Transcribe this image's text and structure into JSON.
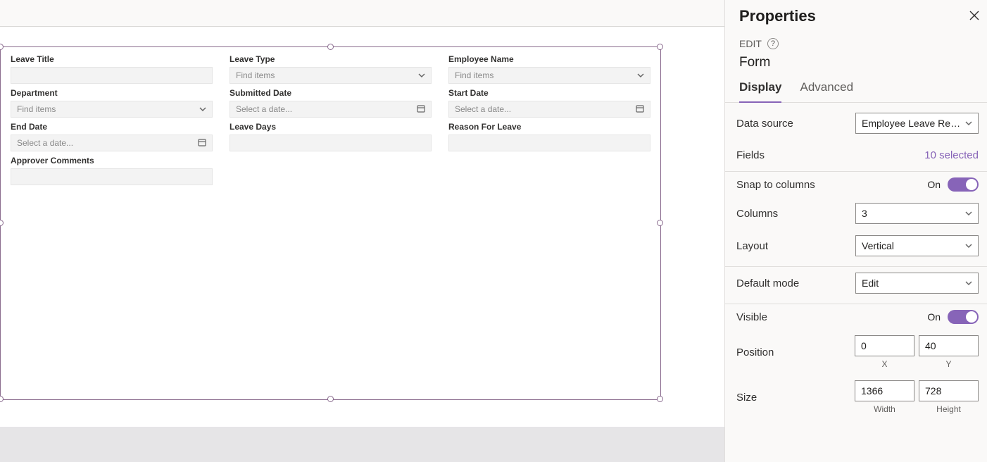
{
  "form": {
    "fields": {
      "leave_title": {
        "label": "Leave Title",
        "placeholder": "",
        "type": "text"
      },
      "leave_type": {
        "label": "Leave Type",
        "placeholder": "Find items",
        "type": "dropdown"
      },
      "employee_name": {
        "label": "Employee Name",
        "placeholder": "Find items",
        "type": "dropdown"
      },
      "department": {
        "label": "Department",
        "placeholder": "Find items",
        "type": "dropdown"
      },
      "submitted_date": {
        "label": "Submitted Date",
        "placeholder": "Select a date...",
        "type": "date"
      },
      "start_date": {
        "label": "Start Date",
        "placeholder": "Select a date...",
        "type": "date"
      },
      "end_date": {
        "label": "End Date",
        "placeholder": "Select a date...",
        "type": "date"
      },
      "leave_days": {
        "label": "Leave Days",
        "placeholder": "",
        "type": "text"
      },
      "reason_for_leave": {
        "label": "Reason For Leave",
        "placeholder": "",
        "type": "text"
      },
      "approver_comments": {
        "label": "Approver Comments",
        "placeholder": "",
        "type": "text"
      }
    }
  },
  "properties": {
    "panel_title": "Properties",
    "edit_label": "EDIT",
    "control_name": "Form",
    "tabs": {
      "display": "Display",
      "advanced": "Advanced"
    },
    "data_source": {
      "label": "Data source",
      "value": "Employee Leave Re…"
    },
    "fields": {
      "label": "Fields",
      "value": "10 selected"
    },
    "snap_to_cols": {
      "label": "Snap to columns",
      "state": "On"
    },
    "columns": {
      "label": "Columns",
      "value": "3"
    },
    "layout": {
      "label": "Layout",
      "value": "Vertical"
    },
    "default_mode": {
      "label": "Default mode",
      "value": "Edit"
    },
    "visible": {
      "label": "Visible",
      "state": "On"
    },
    "position": {
      "label": "Position",
      "x": "0",
      "y": "40",
      "x_label": "X",
      "y_label": "Y"
    },
    "size": {
      "label": "Size",
      "w": "1366",
      "h": "728",
      "w_label": "Width",
      "h_label": "Height"
    },
    "accent_color": "#8764b8"
  }
}
